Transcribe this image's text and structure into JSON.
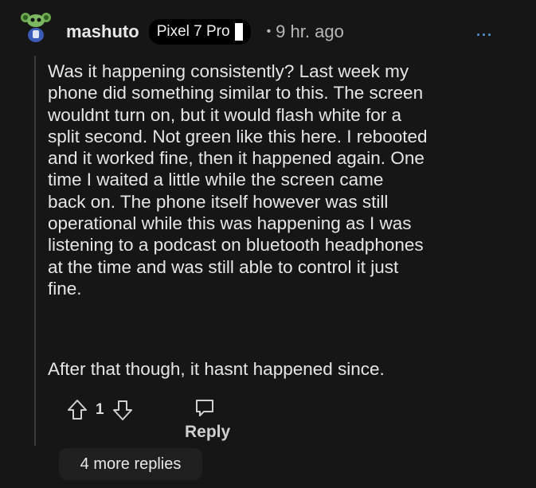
{
  "comment": {
    "username": "mashuto",
    "flair": "Pixel 7 Pro",
    "time_separator": "•",
    "timestamp": "9 hr. ago",
    "more_options": "···",
    "body_paragraph_1": "Was it happening consistently? Last week my\nphone did something similar to this. The screen\nwouldnt turn on, but it would flash white for a\nsplit second. Not green like this here. I rebooted\nand it worked fine, then it happened again. One\ntime I waited a little while the screen came\nback on. The phone itself however was still\noperational while this was happening as I was\nlistening to a podcast on bluetooth headphones\nat the time and was still able to control it just\nfine.",
    "body_paragraph_2": "After that though, it hasnt happened since.",
    "vote_count": "1",
    "reply_label": "Reply",
    "more_replies_label": "4 more replies"
  },
  "icons": {
    "avatar": "snoo-avatar-icon",
    "upvote": "arrow-up-icon",
    "downvote": "arrow-down-icon",
    "reply": "comment-bubble-icon",
    "more": "more-horizontal-icon"
  },
  "colors": {
    "background": "#161616",
    "accent": "#4f9bd9",
    "flair_bg": "#000000",
    "text": "#e4e6e8"
  }
}
